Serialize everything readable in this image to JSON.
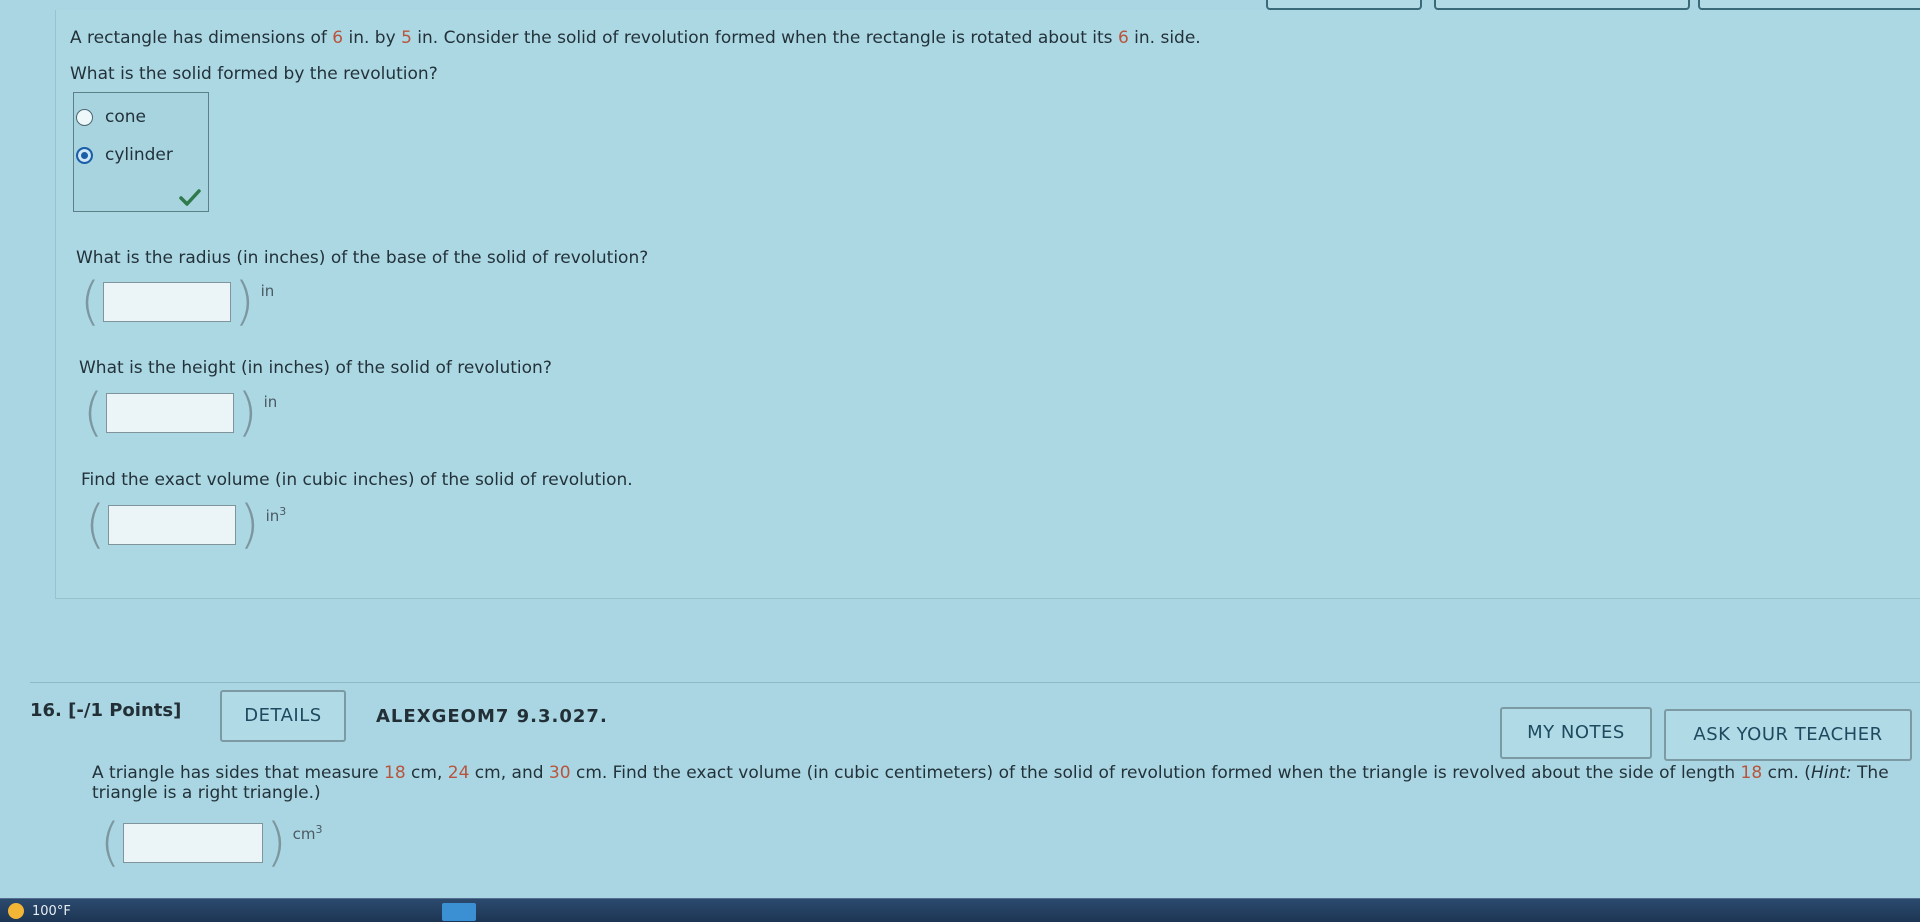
{
  "q15": {
    "prompt_pre": "A rectangle has dimensions of ",
    "dim1": "6",
    "prompt_mid1": " in. by ",
    "dim2": "5",
    "prompt_mid2": " in. Consider the solid of revolution formed when the rectangle is rotated about its ",
    "dim3": "6",
    "prompt_post": " in. side.",
    "solid_question": "What is the solid formed by the revolution?",
    "choices": [
      {
        "label": "cone",
        "selected": false
      },
      {
        "label": "cylinder",
        "selected": true
      }
    ],
    "radius_question": "What is the radius (in inches) of the base of the solid of revolution?",
    "radius_unit": "in",
    "height_question": "What is the height (in inches) of the solid of revolution?",
    "height_unit": "in",
    "volume_question": "Find the exact volume (in cubic inches) of the solid of revolution.",
    "volume_unit": "in",
    "volume_unit_exp": "3"
  },
  "q16": {
    "number": "16.",
    "points": "[-/1 Points]",
    "details_label": "DETAILS",
    "code": "ALEXGEOM7 9.3.027.",
    "my_notes_label": "MY NOTES",
    "ask_teacher_label": "ASK YOUR TEACHER",
    "text_a": "A triangle has sides that measure ",
    "s1": "18",
    "text_b": " cm, ",
    "s2": "24",
    "text_c": " cm, and ",
    "s3": "30",
    "text_d": " cm. Find the exact volume (in cubic centimeters) of the solid of revolution formed when the triangle is revolved about the side of length ",
    "s4": "18",
    "text_e": " cm. (",
    "hint": "Hint:",
    "text_f": " The triangle is a right triangle.)",
    "unit": "cm",
    "unit_exp": "3"
  },
  "taskbar": {
    "temperature": "100°F"
  },
  "colors": {
    "background": "#a9d6e2",
    "number_highlight": "#b8543d",
    "radio_selected": "#1b5fa8",
    "check": "#2e7a4a"
  }
}
